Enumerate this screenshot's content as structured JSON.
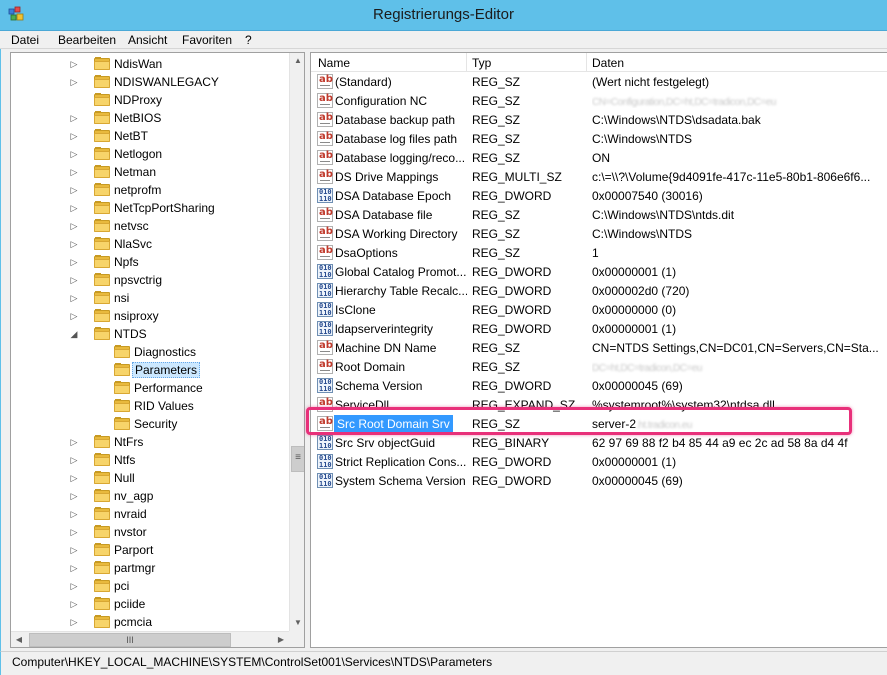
{
  "window": {
    "title": "Registrierungs-Editor",
    "accent": "#5fc0e9",
    "highlight_color": "#e8307a"
  },
  "menu": {
    "items": [
      "Datei",
      "Bearbeiten",
      "Ansicht",
      "Favoriten",
      "?"
    ]
  },
  "tree": {
    "items": [
      {
        "label": "NdisWan",
        "expandable": true,
        "expanded": false,
        "level": 1
      },
      {
        "label": "NDISWANLEGACY",
        "expandable": true,
        "expanded": false,
        "level": 1
      },
      {
        "label": "NDProxy",
        "expandable": false,
        "expanded": false,
        "level": 1
      },
      {
        "label": "NetBIOS",
        "expandable": true,
        "expanded": false,
        "level": 1
      },
      {
        "label": "NetBT",
        "expandable": true,
        "expanded": false,
        "level": 1
      },
      {
        "label": "Netlogon",
        "expandable": true,
        "expanded": false,
        "level": 1
      },
      {
        "label": "Netman",
        "expandable": true,
        "expanded": false,
        "level": 1
      },
      {
        "label": "netprofm",
        "expandable": true,
        "expanded": false,
        "level": 1
      },
      {
        "label": "NetTcpPortSharing",
        "expandable": true,
        "expanded": false,
        "level": 1
      },
      {
        "label": "netvsc",
        "expandable": true,
        "expanded": false,
        "level": 1
      },
      {
        "label": "NlaSvc",
        "expandable": true,
        "expanded": false,
        "level": 1
      },
      {
        "label": "Npfs",
        "expandable": true,
        "expanded": false,
        "level": 1
      },
      {
        "label": "npsvctrig",
        "expandable": true,
        "expanded": false,
        "level": 1
      },
      {
        "label": "nsi",
        "expandable": true,
        "expanded": false,
        "level": 1
      },
      {
        "label": "nsiproxy",
        "expandable": true,
        "expanded": false,
        "level": 1
      },
      {
        "label": "NTDS",
        "expandable": true,
        "expanded": true,
        "level": 1
      },
      {
        "label": "Diagnostics",
        "expandable": false,
        "expanded": false,
        "level": 2
      },
      {
        "label": "Parameters",
        "expandable": false,
        "expanded": false,
        "level": 2,
        "selected": true
      },
      {
        "label": "Performance",
        "expandable": false,
        "expanded": false,
        "level": 2
      },
      {
        "label": "RID Values",
        "expandable": false,
        "expanded": false,
        "level": 2
      },
      {
        "label": "Security",
        "expandable": false,
        "expanded": false,
        "level": 2
      },
      {
        "label": "NtFrs",
        "expandable": true,
        "expanded": false,
        "level": 1
      },
      {
        "label": "Ntfs",
        "expandable": true,
        "expanded": false,
        "level": 1
      },
      {
        "label": "Null",
        "expandable": true,
        "expanded": false,
        "level": 1
      },
      {
        "label": "nv_agp",
        "expandable": true,
        "expanded": false,
        "level": 1
      },
      {
        "label": "nvraid",
        "expandable": true,
        "expanded": false,
        "level": 1
      },
      {
        "label": "nvstor",
        "expandable": true,
        "expanded": false,
        "level": 1
      },
      {
        "label": "Parport",
        "expandable": true,
        "expanded": false,
        "level": 1
      },
      {
        "label": "partmgr",
        "expandable": true,
        "expanded": false,
        "level": 1
      },
      {
        "label": "pci",
        "expandable": true,
        "expanded": false,
        "level": 1
      },
      {
        "label": "pciide",
        "expandable": true,
        "expanded": false,
        "level": 1
      },
      {
        "label": "pcmcia",
        "expandable": true,
        "expanded": false,
        "level": 1
      }
    ],
    "scrollbar": {
      "thumb_glyph": "≡",
      "hthumb_glyph": "III"
    }
  },
  "values": {
    "columns": {
      "name": "Name",
      "type": "Typ",
      "data": "Daten"
    },
    "rows": [
      {
        "icon": "string-value-icon",
        "name": "(Standard)",
        "type": "REG_SZ",
        "data": "(Wert nicht festgelegt)"
      },
      {
        "icon": "string-value-icon",
        "name": "Configuration NC",
        "type": "REG_SZ",
        "data": "CN=Configuration,DC=ht,DC=tradicon,DC=eu",
        "blurred": true
      },
      {
        "icon": "string-value-icon",
        "name": "Database backup path",
        "type": "REG_SZ",
        "data": "C:\\Windows\\NTDS\\dsadata.bak"
      },
      {
        "icon": "string-value-icon",
        "name": "Database log files path",
        "type": "REG_SZ",
        "data": "C:\\Windows\\NTDS"
      },
      {
        "icon": "string-value-icon",
        "name": "Database logging/reco...",
        "type": "REG_SZ",
        "data": "ON"
      },
      {
        "icon": "string-value-icon",
        "name": "DS Drive Mappings",
        "type": "REG_MULTI_SZ",
        "data": "c:\\=\\\\?\\Volume{9d4091fe-417c-11e5-80b1-806e6f6..."
      },
      {
        "icon": "binary-value-icon",
        "name": "DSA Database Epoch",
        "type": "REG_DWORD",
        "data": "0x00007540 (30016)"
      },
      {
        "icon": "string-value-icon",
        "name": "DSA Database file",
        "type": "REG_SZ",
        "data": "C:\\Windows\\NTDS\\ntds.dit"
      },
      {
        "icon": "string-value-icon",
        "name": "DSA Working Directory",
        "type": "REG_SZ",
        "data": "C:\\Windows\\NTDS"
      },
      {
        "icon": "string-value-icon",
        "name": "DsaOptions",
        "type": "REG_SZ",
        "data": "1"
      },
      {
        "icon": "binary-value-icon",
        "name": "Global Catalog Promot...",
        "type": "REG_DWORD",
        "data": "0x00000001 (1)"
      },
      {
        "icon": "binary-value-icon",
        "name": "Hierarchy Table Recalc...",
        "type": "REG_DWORD",
        "data": "0x000002d0 (720)"
      },
      {
        "icon": "binary-value-icon",
        "name": "IsClone",
        "type": "REG_DWORD",
        "data": "0x00000000 (0)"
      },
      {
        "icon": "binary-value-icon",
        "name": "ldapserverintegrity",
        "type": "REG_DWORD",
        "data": "0x00000001 (1)"
      },
      {
        "icon": "string-value-icon",
        "name": "Machine DN Name",
        "type": "REG_SZ",
        "data": "CN=NTDS Settings,CN=DC01,CN=Servers,CN=Sta..."
      },
      {
        "icon": "string-value-icon",
        "name": "Root Domain",
        "type": "REG_SZ",
        "data": "DC=ht,DC=tradicon,DC=eu",
        "blurred": true
      },
      {
        "icon": "binary-value-icon",
        "name": "Schema Version",
        "type": "REG_DWORD",
        "data": "0x00000045 (69)"
      },
      {
        "icon": "string-value-icon",
        "name": "ServiceDll",
        "type": "REG_EXPAND_SZ",
        "data": "%systemroot%\\system32\\ntdsa.dll"
      },
      {
        "icon": "string-value-icon",
        "name": "Src Root Domain Srv",
        "type": "REG_SZ",
        "data": "server-2",
        "data_blurred_suffix": ".ht.tradicon.eu",
        "selected": true
      },
      {
        "icon": "binary-value-icon",
        "name": "Src Srv objectGuid",
        "type": "REG_BINARY",
        "data": "62 97 69 88 f2 b4 85 44 a9 ec 2c ad 58 8a d4 4f"
      },
      {
        "icon": "binary-value-icon",
        "name": "Strict Replication Cons...",
        "type": "REG_DWORD",
        "data": "0x00000001 (1)"
      },
      {
        "icon": "binary-value-icon",
        "name": "System Schema Version",
        "type": "REG_DWORD",
        "data": "0x00000045 (69)"
      }
    ]
  },
  "status": {
    "path": "Computer\\HKEY_LOCAL_MACHINE\\SYSTEM\\ControlSet001\\Services\\NTDS\\Parameters"
  }
}
